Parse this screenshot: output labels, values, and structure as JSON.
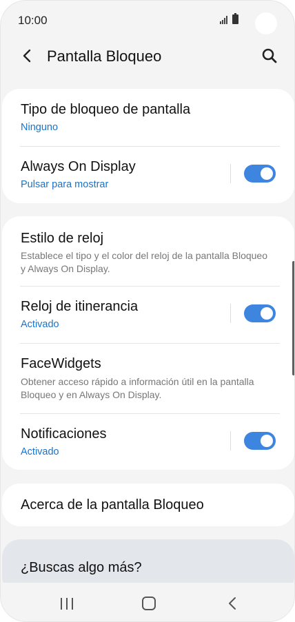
{
  "status_bar": {
    "time": "10:00"
  },
  "header": {
    "title": "Pantalla Bloqueo"
  },
  "section1": {
    "items": [
      {
        "title": "Tipo de bloqueo de pantalla",
        "subtitle": "Ninguno"
      },
      {
        "title": "Always On Display",
        "subtitle": "Pulsar para mostrar",
        "toggle": "on"
      }
    ]
  },
  "section2": {
    "items": [
      {
        "title": "Estilo de reloj",
        "description": "Establece el tipo y el color del reloj de la pantalla Bloqueo y Always On Display."
      },
      {
        "title": "Reloj de itinerancia",
        "subtitle": "Activado",
        "toggle": "on"
      },
      {
        "title": "FaceWidgets",
        "description": "Obtener acceso rápido a información útil en la pantalla Bloqueo y en Always On Display."
      },
      {
        "title": "Notificaciones",
        "subtitle": "Activado",
        "toggle": "on"
      }
    ]
  },
  "section3": {
    "title": "Acerca de la pantalla Bloqueo"
  },
  "section4": {
    "title": "¿Buscas algo más?"
  },
  "colors": {
    "accent": "#3e85e0",
    "link": "#1a73c9",
    "background": "#f4f4f4",
    "card": "#ffffff"
  },
  "icons": [
    "back-icon",
    "search-icon",
    "signal-icon",
    "battery-icon",
    "nav-recent-icon",
    "nav-home-icon",
    "nav-back-icon"
  ]
}
